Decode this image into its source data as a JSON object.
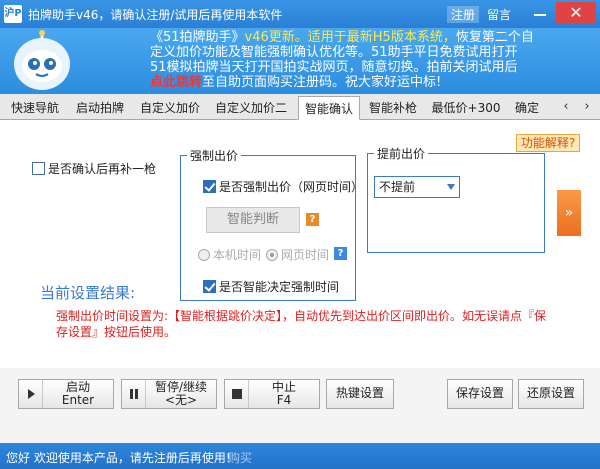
{
  "window": {
    "icon_text": "沪P",
    "title": "拍牌助手v46，请确认注册/试用后再使用本软件",
    "register": "注册",
    "message": "留言",
    "close": "✕"
  },
  "banner": {
    "line1_prefix": "《51拍牌助手》",
    "line1_hl": "v46更新。适用于最新H5版本系统，",
    "line1_tail": "恢复第二个自",
    "line2": "定义加价功能及智能强制确认优化等。51助手平日免费试用打开",
    "line3": "51模拟拍牌当天打开国拍实战网页，随意切换。拍前关闭试用后",
    "line4_red": "点此跳转",
    "line4_tail": "至自助页面购买注册码。祝大家好运中标!"
  },
  "tabs": [
    {
      "label": "快速导航"
    },
    {
      "label": "启动拍牌"
    },
    {
      "label": "自定义加价"
    },
    {
      "label": "自定义加价二"
    },
    {
      "label": "智能确认",
      "active": true
    },
    {
      "label": "智能补枪"
    },
    {
      "label": "最低价+300"
    },
    {
      "label": "确定"
    }
  ],
  "tab_arrows": {
    "left": "‹",
    "right": "›"
  },
  "panel": {
    "help": "功能解释?",
    "confirm_again": {
      "label": "是否确认后再补一枪",
      "checked": false
    },
    "force_bid": {
      "title": "强制出价",
      "force_check": {
        "label": "是否强制出价（网页时间）",
        "checked": true
      },
      "smart_box": "智能判断",
      "radio_local": "本机时间",
      "radio_web": "网页时间",
      "smart_time": {
        "label": "是否智能决定强制时间",
        "checked": true
      },
      "q": "?"
    },
    "advance_bid": {
      "title": "提前出价",
      "select_value": "不提前"
    },
    "expand": "»",
    "result_title": "当前设置结果:",
    "result_text": "强制出价时间设置为:【智能根据跳价决定】，自动优先到达出价区间即出价。如无误请点『保存设置』按钮后使用。"
  },
  "buttons": {
    "start": {
      "line1": "启动",
      "line2": "Enter"
    },
    "pause": {
      "line1": "暂停/继续",
      "line2": "<无>"
    },
    "stop": {
      "line1": "中止",
      "line2": "F4"
    },
    "hotkey": "热键设置",
    "save": "保存设置",
    "restore": "还原设置"
  },
  "status": {
    "text": "您好 欢迎使用本产品，请先注册后再使用!",
    "buy": "购买"
  }
}
